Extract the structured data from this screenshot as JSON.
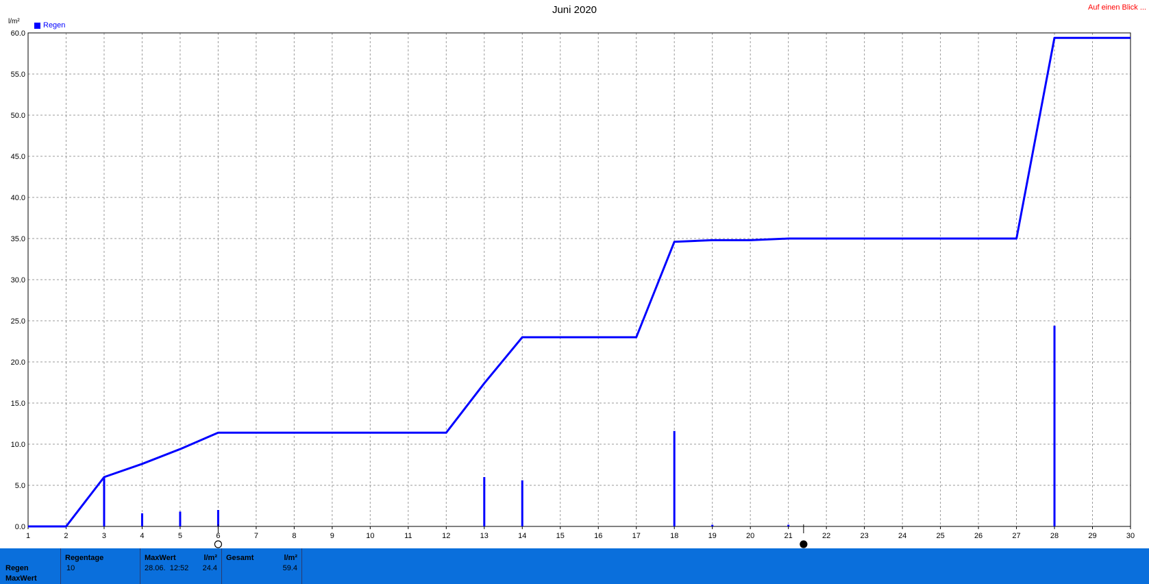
{
  "top_link": "Auf einen Blick ...",
  "y_unit_label": "l/m²",
  "chart_data": {
    "type": "line",
    "title": "Juni 2020",
    "xlabel": "",
    "ylabel": "l/m²",
    "xlim": [
      1,
      30
    ],
    "ylim": [
      0,
      60
    ],
    "x_ticks": [
      1,
      2,
      3,
      4,
      5,
      6,
      7,
      8,
      9,
      10,
      11,
      12,
      13,
      14,
      15,
      16,
      17,
      18,
      19,
      20,
      21,
      22,
      23,
      24,
      25,
      26,
      27,
      28,
      29,
      30
    ],
    "y_ticks": [
      "0.0",
      "5.0",
      "10.0",
      "15.0",
      "20.0",
      "25.0",
      "30.0",
      "35.0",
      "40.0",
      "45.0",
      "50.0",
      "55.0",
      "60.0"
    ],
    "grid": true,
    "legend": {
      "placement": "top-left",
      "entries": [
        "Regen"
      ]
    },
    "series": [
      {
        "name": "Regen",
        "kind": "cumulative-line",
        "color": "#0000ff",
        "points": [
          [
            1,
            0
          ],
          [
            2,
            0
          ],
          [
            3,
            6.0
          ],
          [
            4,
            7.6
          ],
          [
            5,
            9.4
          ],
          [
            6,
            11.4
          ],
          [
            12,
            11.4
          ],
          [
            13,
            17.4
          ],
          [
            14,
            23.0
          ],
          [
            17,
            23.0
          ],
          [
            18,
            34.6
          ],
          [
            19,
            34.8
          ],
          [
            20,
            34.8
          ],
          [
            21,
            35.0
          ],
          [
            27,
            35.0
          ],
          [
            28,
            59.4
          ],
          [
            30,
            59.4
          ]
        ]
      },
      {
        "name": "Regen",
        "kind": "daily-bars",
        "color": "#0000ff",
        "points": [
          [
            3,
            6.0
          ],
          [
            4,
            1.6
          ],
          [
            5,
            1.8
          ],
          [
            6,
            2.0
          ],
          [
            13,
            6.0
          ],
          [
            14,
            5.6
          ],
          [
            18,
            11.6
          ],
          [
            19,
            0.2
          ],
          [
            21,
            0.2
          ],
          [
            28,
            24.4
          ]
        ]
      }
    ],
    "markers": [
      {
        "symbol": "sun-icon",
        "x": 6
      },
      {
        "symbol": "moon-icon",
        "x": 21.4
      }
    ]
  },
  "panel": {
    "row_labels": [
      "Regen",
      "MaxWert"
    ],
    "regentage": {
      "label": "Regentage",
      "value": "10"
    },
    "maxwert": {
      "label": "MaxWert",
      "unit": "l/m²",
      "date": "28.06.  12:52",
      "value": "24.4"
    },
    "gesamt": {
      "label": "Gesamt",
      "unit": "l/m²",
      "value": "59.4"
    }
  },
  "colors": {
    "panel_bg": "#0a6fdc",
    "series": "#0000ff",
    "link": "#ff0000"
  }
}
